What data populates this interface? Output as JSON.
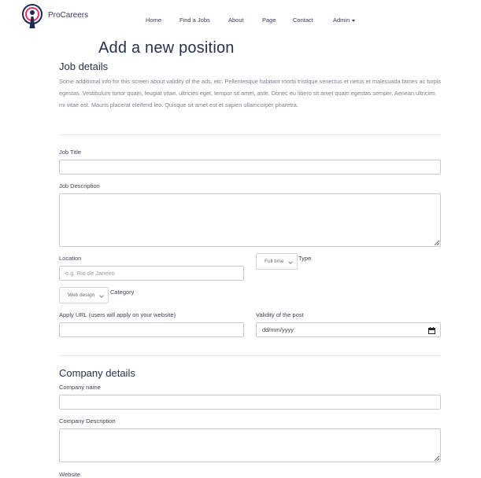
{
  "brand": {
    "name": "ProCareers"
  },
  "nav": {
    "items": [
      {
        "label": "Home"
      },
      {
        "label": "Find a Jobs"
      },
      {
        "label": "About"
      },
      {
        "label": "Page"
      },
      {
        "label": "Contact"
      },
      {
        "label": "Admin"
      }
    ]
  },
  "page": {
    "title": "Add a new position"
  },
  "job_details": {
    "heading": "Job details",
    "info": "Some additional info for this screen about validity of the ads, etc. Pellentesque habitant morbi tristique senectus et netus et malesuada fames ac turpis egestas. Vestibulum tortor quam, feugiat vitae, ultricies eget, tempor sit amet, ante. Donec eu libero sit amet quam egestas semper. Aenean ultricies mi vitae est. Mauris placerat eleifend leo. Quisque sit amet est et sapien ullamcorper pharetra.",
    "job_title_label": "Job Title",
    "job_title_value": "",
    "job_description_label": "Job Description",
    "job_description_value": "",
    "location_label": "Location",
    "location_placeholder": "e.g. Rio de Janeiro",
    "type_label": "Type",
    "type_selected": "Full time",
    "category_label": "Category",
    "category_selected": "Web design",
    "apply_url_label": "Apply URL (users will apply on your website)",
    "apply_url_value": "",
    "validity_label": "Validity of the post",
    "validity_placeholder": "dd/mm/yyyy"
  },
  "company_details": {
    "heading": "Company details",
    "name_label": "Company name",
    "name_value": "",
    "description_label": "Company Description",
    "description_value": "",
    "website_label": "Website"
  },
  "icons": {
    "logo": "podcast-person-logo-icon",
    "admin_caret": "caret-down-icon",
    "select_caret": "chevron-down-icon",
    "calendar": "calendar-icon",
    "resize": "resize-grip-icon"
  },
  "colors": {
    "brand_pink": "#e8336e",
    "brand_navy": "#1f2a52",
    "text_dark": "#2b2f4a"
  }
}
